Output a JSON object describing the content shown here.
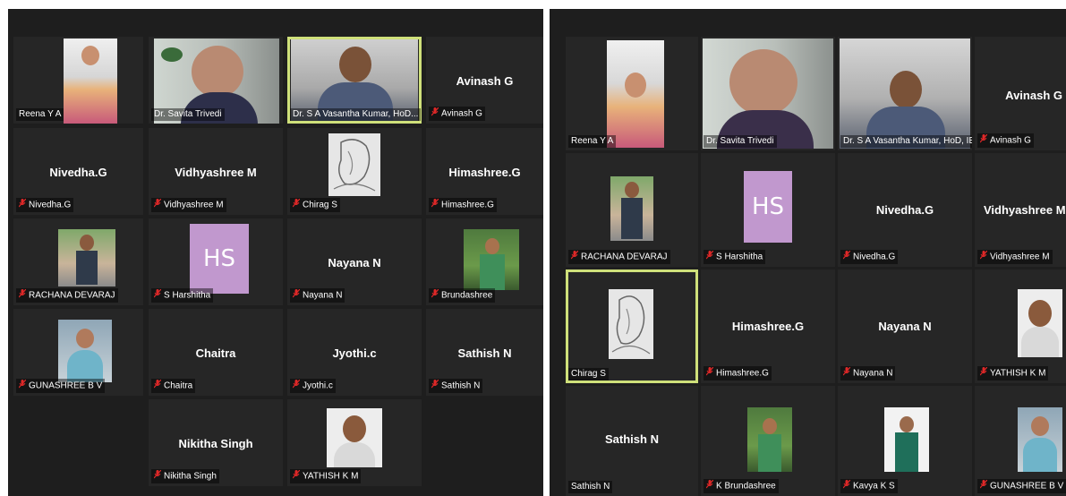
{
  "window_title": "Zoom Meeting - Gallery View",
  "left_gallery": {
    "tiles": [
      {
        "name": "Reena Y A",
        "label": "Reena Y A",
        "muted": false
      },
      {
        "name": "Dr. Savita Trivedi",
        "label": "Dr. Savita Trivedi",
        "muted": false
      },
      {
        "name": "Dr. S A Vasantha Kumar, HoD",
        "label": "Dr. S A Vasantha Kumar, HoD...",
        "muted": false
      },
      {
        "name": "Avinash G",
        "label": "Avinash G",
        "muted": true
      },
      {
        "name": "Nivedha.G",
        "label": "Nivedha.G",
        "muted": true
      },
      {
        "name": "Vidhyashree M",
        "label": "Vidhyashree M",
        "muted": true
      },
      {
        "name": "Chirag S",
        "label": "Chirag S",
        "muted": true
      },
      {
        "name": "Himashree.G",
        "label": "Himashree.G",
        "muted": true
      },
      {
        "name": "RACHANA DEVARAJ",
        "label": "RACHANA DEVARAJ",
        "muted": true
      },
      {
        "name": "S Harshitha",
        "label": "S Harshitha",
        "muted": true,
        "initials": "HS"
      },
      {
        "name": "Nayana N",
        "label": "Nayana N",
        "muted": true
      },
      {
        "name": "Brundashree",
        "label": "Brundashree",
        "muted": true
      },
      {
        "name": "GUNASHREE B V",
        "label": "GUNASHREE B V",
        "muted": true
      },
      {
        "name": "Chaitra",
        "label": "Chaitra",
        "muted": true
      },
      {
        "name": "Jyothi.c",
        "label": "Jyothi.c",
        "muted": true
      },
      {
        "name": "Sathish N",
        "label": "Sathish N",
        "muted": true
      },
      {
        "name": "Nikitha Singh",
        "label": "Nikitha Singh",
        "muted": true
      },
      {
        "name": "YATHISH K M",
        "label": "YATHISH K M",
        "muted": true
      }
    ]
  },
  "right_gallery": {
    "tiles": [
      {
        "name": "Reena Y A",
        "label": "Reena Y A",
        "muted": false
      },
      {
        "name": "Dr. Savita Trivedi",
        "label": "Dr. Savita Trivedi",
        "muted": false
      },
      {
        "name": "Dr. S A Vasantha Kumar, HoD",
        "label": "Dr. S A Vasantha Kumar, HoD, IEM, CS...",
        "muted": false
      },
      {
        "name": "Avinash G",
        "label": "Avinash G",
        "muted": true
      },
      {
        "name": "RACHANA DEVARAJ",
        "label": "RACHANA DEVARAJ",
        "muted": true
      },
      {
        "name": "S Harshitha",
        "label": "S Harshitha",
        "muted": true,
        "initials": "HS"
      },
      {
        "name": "Nivedha.G",
        "label": "Nivedha.G",
        "muted": true
      },
      {
        "name": "Vidhyashree M",
        "label": "Vidhyashree M",
        "muted": true
      },
      {
        "name": "Chirag S",
        "label": "Chirag S",
        "muted": false
      },
      {
        "name": "Himashree.G",
        "label": "Himashree.G",
        "muted": true
      },
      {
        "name": "Nayana N",
        "label": "Nayana N",
        "muted": true
      },
      {
        "name": "YATHISH K M",
        "label": "YATHISH K M",
        "muted": true
      },
      {
        "name": "Sathish N",
        "label": "Sathish N",
        "muted": false
      },
      {
        "name": "K Brundashree",
        "label": "K Brundashree",
        "muted": true
      },
      {
        "name": "Kavya K S",
        "label": "Kavya K S",
        "muted": true
      },
      {
        "name": "GUNASHREE B V",
        "label": "GUNASHREE B V",
        "muted": true
      }
    ]
  },
  "colors": {
    "background": "#1e1e1e",
    "tile": "#262626",
    "active_speaker_border": "#cfe07a",
    "muted_icon": "#e02828",
    "avatar_initials_bg": "#c198ce"
  }
}
